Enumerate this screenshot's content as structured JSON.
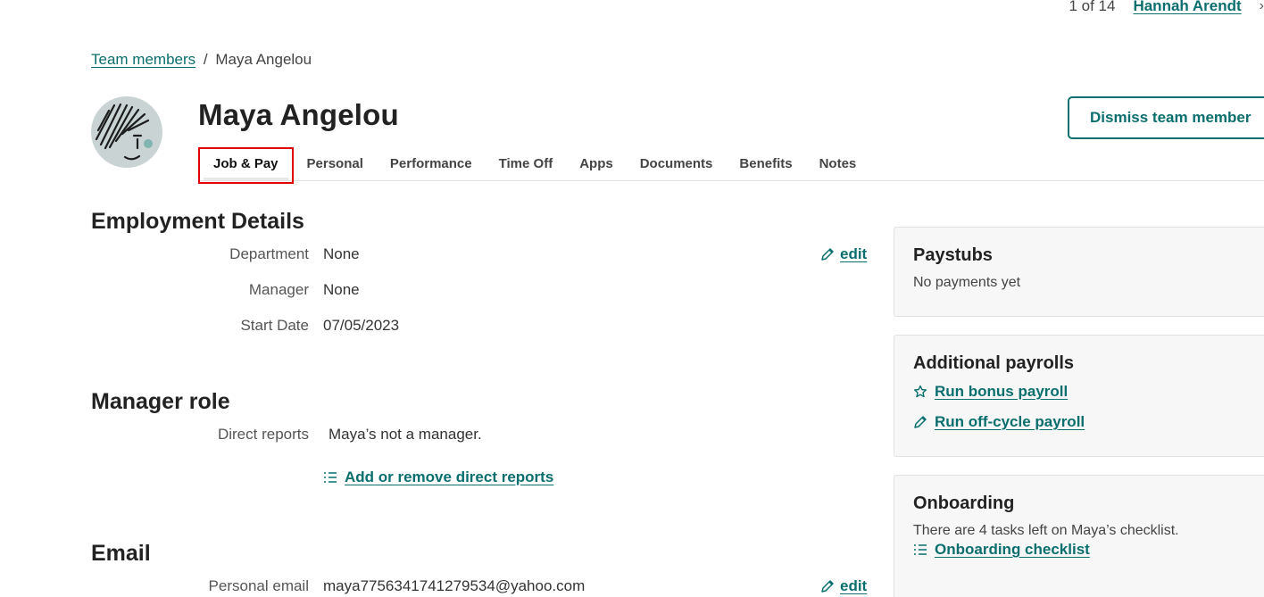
{
  "pager": {
    "count": "1 of 14",
    "next_name": "Hannah Arendt",
    "chevron": "›"
  },
  "breadcrumb": {
    "parent": "Team members",
    "separator": "/",
    "current": "Maya Angelou"
  },
  "profile": {
    "name": "Maya Angelou",
    "avatar_icon": "sketched-face-avatar"
  },
  "actions": {
    "dismiss_label": "Dismiss team member"
  },
  "tabs": [
    {
      "label": "Job & Pay",
      "active": true
    },
    {
      "label": "Personal"
    },
    {
      "label": "Performance"
    },
    {
      "label": "Time Off"
    },
    {
      "label": "Apps"
    },
    {
      "label": "Documents"
    },
    {
      "label": "Benefits"
    },
    {
      "label": "Notes"
    }
  ],
  "employment": {
    "title": "Employment Details",
    "edit_label": "edit",
    "rows": [
      {
        "label": "Department",
        "value": "None"
      },
      {
        "label": "Manager",
        "value": "None"
      },
      {
        "label": "Start Date",
        "value": "07/05/2023"
      }
    ]
  },
  "manager_role": {
    "title": "Manager role",
    "label": "Direct reports",
    "value": "Maya’s not a manager.",
    "link": "Add or remove direct reports"
  },
  "email": {
    "title": "Email",
    "label": "Personal email",
    "value": "maya7756341741279534@yahoo.com",
    "edit_label": "edit"
  },
  "paystubs": {
    "title": "Paystubs",
    "text": "No payments yet"
  },
  "additional_payrolls": {
    "title": "Additional payrolls",
    "bonus_link": "Run bonus payroll",
    "offcycle_link": "Run off-cycle payroll"
  },
  "onboarding": {
    "title": "Onboarding",
    "text": "There are 4 tasks left on Maya’s checklist.",
    "link": "Onboarding checklist"
  },
  "colors": {
    "accent": "#0a6e6e",
    "highlight": "#e00000",
    "card_bg": "#f7f7f7"
  }
}
